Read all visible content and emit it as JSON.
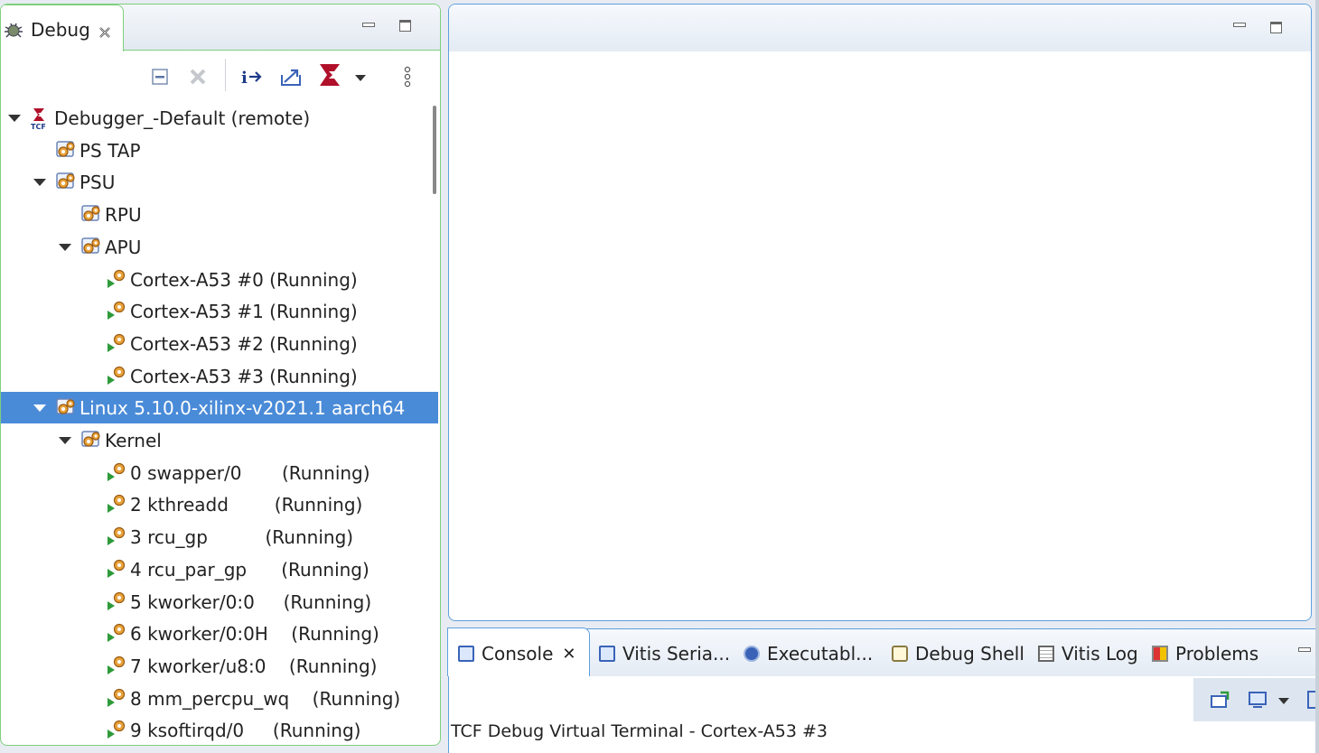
{
  "debug_view": {
    "tab_label": "Debug",
    "tree": [
      {
        "label": "Debugger_-Default (remote)",
        "level": 0,
        "expanded": true,
        "icon": "tcf-icon"
      },
      {
        "label": "PS TAP",
        "level": 1,
        "expanded": false,
        "icon": "target-group-icon"
      },
      {
        "label": "PSU",
        "level": 1,
        "expanded": true,
        "icon": "target-group-icon"
      },
      {
        "label": "RPU",
        "level": 2,
        "expanded": false,
        "icon": "target-group-icon"
      },
      {
        "label": "APU",
        "level": 2,
        "expanded": true,
        "icon": "target-group-icon"
      },
      {
        "label": "Cortex-A53 #0 (Running)",
        "level": 3,
        "icon": "running-thread-icon"
      },
      {
        "label": "Cortex-A53 #1 (Running)",
        "level": 3,
        "icon": "running-thread-icon"
      },
      {
        "label": "Cortex-A53 #2 (Running)",
        "level": 3,
        "icon": "running-thread-icon"
      },
      {
        "label": "Cortex-A53 #3 (Running)",
        "level": 3,
        "icon": "running-thread-icon"
      },
      {
        "label": "Linux 5.10.0-xilinx-v2021.1 aarch64",
        "level": 1,
        "expanded": true,
        "icon": "target-group-icon",
        "selected": true
      },
      {
        "label": "Kernel",
        "level": 2,
        "expanded": true,
        "icon": "target-group-icon"
      },
      {
        "label": "0 swapper/0       (Running)",
        "level": 3,
        "icon": "running-thread-icon"
      },
      {
        "label": "2 kthreadd        (Running)",
        "level": 3,
        "icon": "running-thread-icon"
      },
      {
        "label": "3 rcu_gp          (Running)",
        "level": 3,
        "icon": "running-thread-icon"
      },
      {
        "label": "4 rcu_par_gp      (Running)",
        "level": 3,
        "icon": "running-thread-icon"
      },
      {
        "label": "5 kworker/0:0     (Running)",
        "level": 3,
        "icon": "running-thread-icon"
      },
      {
        "label": "6 kworker/0:0H    (Running)",
        "level": 3,
        "icon": "running-thread-icon"
      },
      {
        "label": "7 kworker/u8:0    (Running)",
        "level": 3,
        "icon": "running-thread-icon"
      },
      {
        "label": "8 mm_percpu_wq    (Running)",
        "level": 3,
        "icon": "running-thread-icon"
      },
      {
        "label": "9 ksoftirqd/0     (Running)",
        "level": 3,
        "icon": "running-thread-icon"
      }
    ]
  },
  "console": {
    "tabs": [
      {
        "label": "Console",
        "icon": "console-icon"
      },
      {
        "label": "Vitis Seria...",
        "icon": "serial-terminal-icon"
      },
      {
        "label": "Executabl...",
        "icon": "executable-icon"
      },
      {
        "label": "Debug Shell",
        "icon": "debug-shell-icon"
      },
      {
        "label": "Vitis Log",
        "icon": "log-icon"
      },
      {
        "label": "Problems",
        "icon": "problems-icon"
      }
    ],
    "title": "TCF Debug Virtual Terminal - Cortex-A53 #3"
  },
  "colors": {
    "selection": "#4a8bd8",
    "accent_green": "#7ed07e",
    "accent_blue": "#5da0e0",
    "xilinx_red": "#b0102a"
  }
}
